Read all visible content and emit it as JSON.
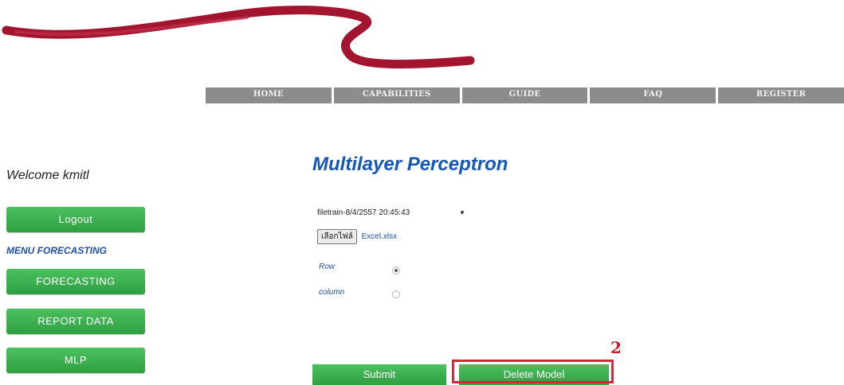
{
  "nav": {
    "items": [
      "HOME",
      "CAPABILITIES",
      "GUIDE",
      "FAQ",
      "REGISTER"
    ]
  },
  "sidebar": {
    "welcome": "Welcome kmitl",
    "logout_label": "Logout",
    "menu_label": "MENU FORECASTING",
    "items": [
      "FORECASTING",
      "REPORT DATA",
      "MLP"
    ]
  },
  "main": {
    "title": "Multilayer Perceptron",
    "file_select_value": "filetrain-8/4/2557 20:45:43",
    "choose_file_label": "เลือกไฟล์",
    "chosen_file": "Excel.xlsx",
    "radio_row_label": "Row",
    "radio_column_label": "column",
    "selected_orientation": "Row",
    "submit_label": "Submit",
    "delete_label": "Delete Model"
  },
  "annotation": {
    "number": "2",
    "color": "#d42a37"
  },
  "colors": {
    "button_green": "#3cb152",
    "title_blue": "#1457b8",
    "nav_gray": "#8c8c8c",
    "logo_red": "#a3142f"
  }
}
